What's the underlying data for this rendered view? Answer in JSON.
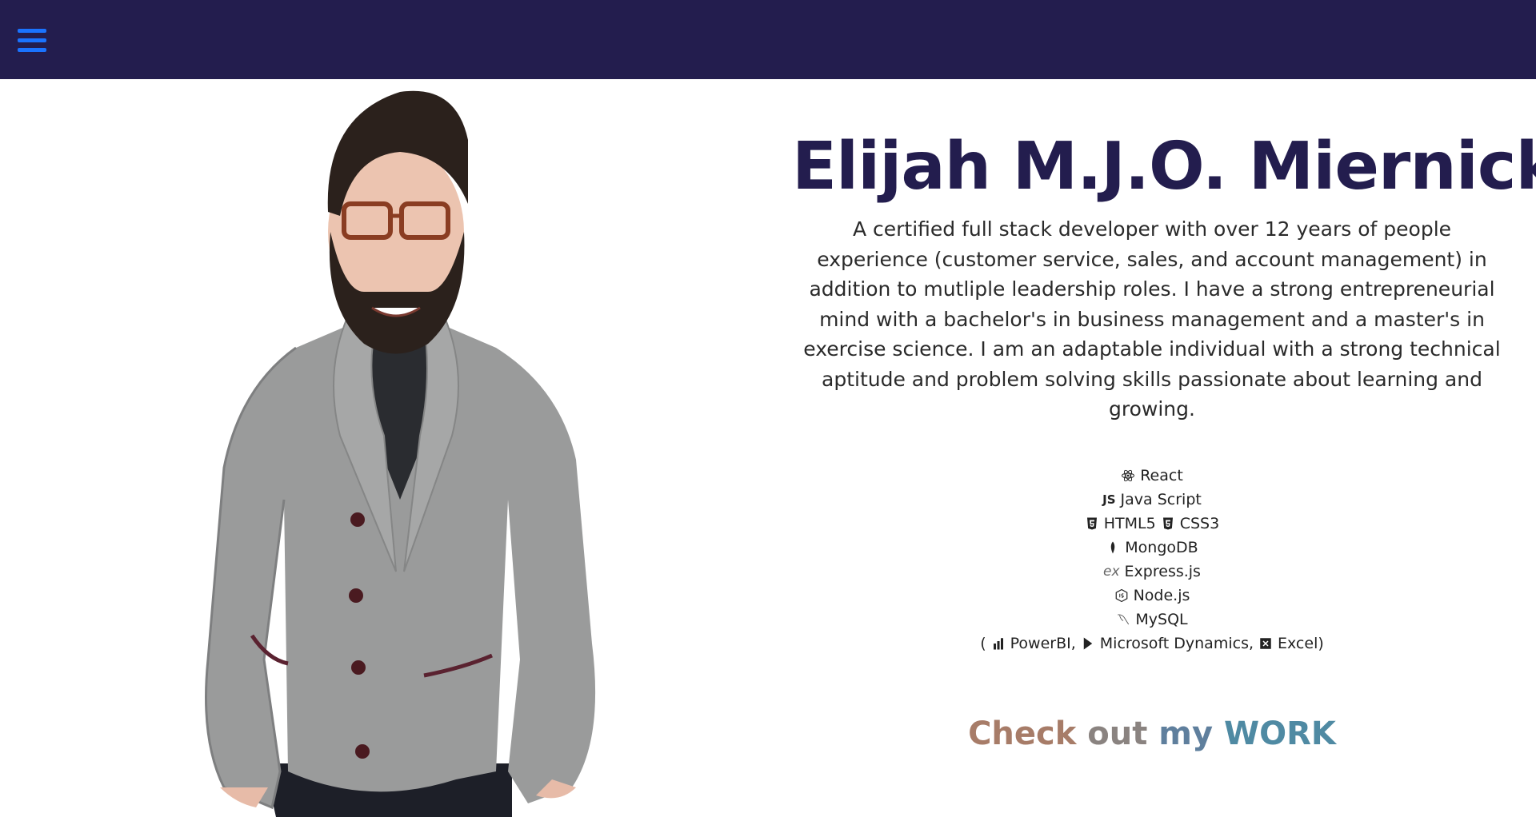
{
  "nav": {
    "menu_icon": "hamburger-menu-icon",
    "bar_color": "#231d4e",
    "icon_color": "#1a73ff"
  },
  "hero": {
    "name": "Elijah M.J.O. Miernicki",
    "bio": "A certified full stack developer with over 12 years of people experience (customer service, sales, and account management) in addition to mutliple leadership roles. I have a strong entrepreneurial mind with a bachelor's in business management and a master's in exercise science. I am an adaptable individual with a strong technical aptitude and problem solving skills passionate about learning and growing.",
    "name_color": "#231d4e"
  },
  "skills": {
    "react": "React",
    "javascript_icon": "JS",
    "javascript": "Java Script",
    "html5": "HTML5",
    "css3": "CSS3",
    "mongodb": "MongoDB",
    "express_icon": "ex",
    "express": "Express.js",
    "nodejs": "Node.js",
    "mysql": "MySQL",
    "open_paren": "(",
    "powerbi": "PowerBI,",
    "dynamics": "Microsoft Dynamics,",
    "excel": "Excel)"
  },
  "cta": {
    "w1": "Check",
    "w2": "out",
    "w3": "my",
    "w4": "WORK"
  }
}
